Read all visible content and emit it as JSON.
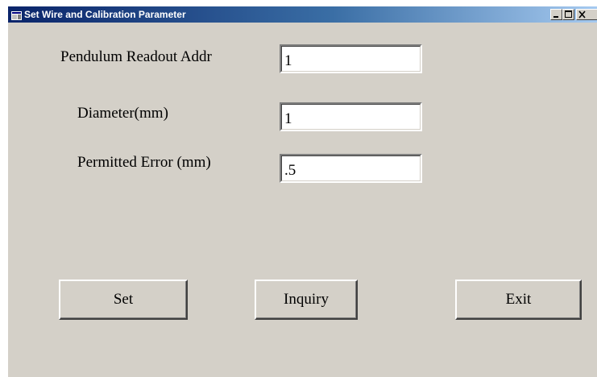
{
  "window": {
    "title": "Set Wire and Calibration Parameter",
    "icon": "window-app-icon",
    "controls": {
      "minimize": "minimize-icon",
      "maximize": "maximize-icon",
      "close": "close-icon"
    }
  },
  "form": {
    "fields": [
      {
        "label": "Pendulum Readout Addr",
        "value": "1"
      },
      {
        "label": "Diameter(mm)",
        "value": "1"
      },
      {
        "label": "Permitted Error (mm)",
        "value": ".5"
      }
    ]
  },
  "buttons": {
    "set": "Set",
    "inquiry": "Inquiry",
    "exit": "Exit"
  },
  "colors": {
    "titlebar_start": "#0a246a",
    "titlebar_end": "#a6caf0",
    "face": "#d4d0c8"
  }
}
